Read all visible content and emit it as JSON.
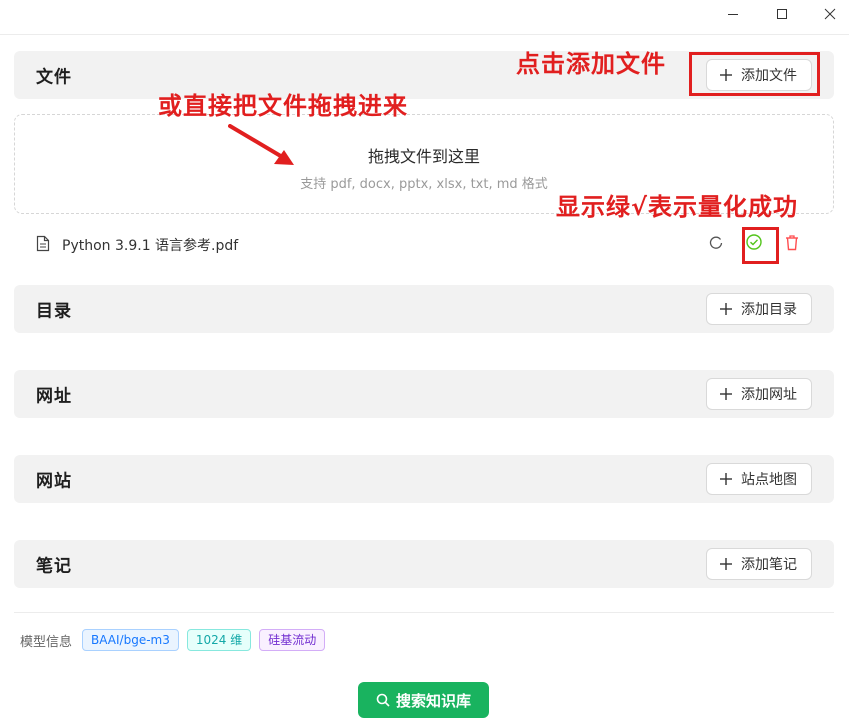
{
  "window": {
    "minimize_icon": "minimize-icon",
    "maximize_icon": "maximize-icon",
    "close_icon": "close-icon"
  },
  "sections": {
    "files": {
      "title": "文件",
      "button_label": "添加文件"
    },
    "directory": {
      "title": "目录",
      "button_label": "添加目录"
    },
    "url": {
      "title": "网址",
      "button_label": "添加网址"
    },
    "website": {
      "title": "网站",
      "button_label": "站点地图"
    },
    "notes": {
      "title": "笔记",
      "button_label": "添加笔记"
    }
  },
  "dropzone": {
    "title": "拖拽文件到这里",
    "subtitle": "支持 pdf, docx, pptx, xlsx, txt, md 格式"
  },
  "file_list": [
    {
      "name": "Python 3.9.1 语言参考.pdf",
      "status": "success"
    }
  ],
  "footer": {
    "model_label": "模型信息",
    "tags": [
      "BAAI/bge-m3",
      "1024 维",
      "硅基流动"
    ],
    "search_button": "搜索知识库"
  },
  "annotations": {
    "click_add": "点击添加文件",
    "drag_here": "或直接把文件拖拽进来",
    "success_hint": "显示绿√表示量化成功"
  },
  "colors": {
    "accent_green": "#19b35f",
    "annotation_red": "#e11f1f",
    "delete_red": "#ff4d4f",
    "success_green": "#52c41a"
  }
}
